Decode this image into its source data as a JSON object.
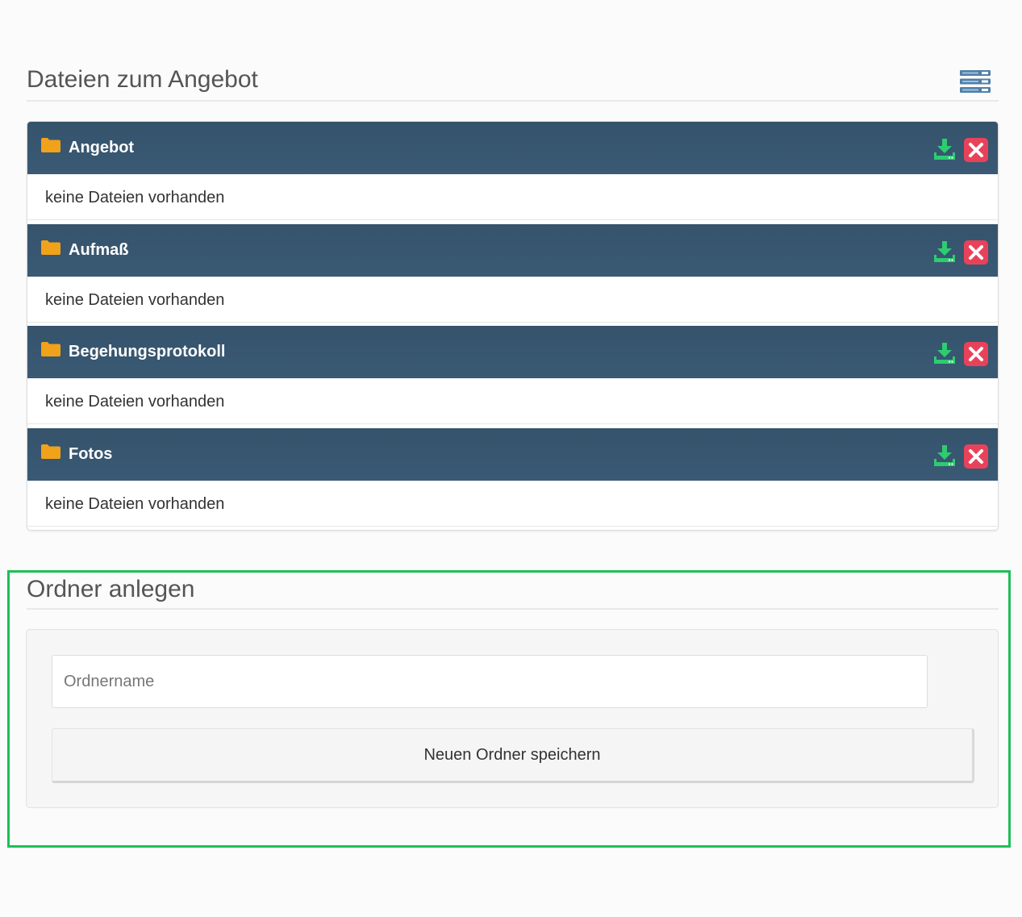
{
  "files_section": {
    "title": "Dateien zum Angebot",
    "list_toggle_icon": "list-view-icon",
    "folders": [
      {
        "name": "Angebot",
        "empty_text": "keine Dateien vorhanden"
      },
      {
        "name": "Aufmaß",
        "empty_text": "keine Dateien vorhanden"
      },
      {
        "name": "Begehungsprotokoll",
        "empty_text": "keine Dateien vorhanden"
      },
      {
        "name": "Fotos",
        "empty_text": "keine Dateien vorhanden"
      }
    ]
  },
  "create_section": {
    "title": "Ordner anlegen",
    "input_placeholder": "Ordnername",
    "input_value": "",
    "save_label": "Neuen Ordner speichern"
  },
  "icons": {
    "folder": "folder-icon",
    "download": "download-icon",
    "delete": "delete-icon"
  },
  "colors": {
    "header_bar": "#37566f",
    "folder_icon": "#f0a21b",
    "download_icon": "#2ecc71",
    "delete_icon": "#e8425a",
    "highlight_frame": "#1dbf58"
  }
}
